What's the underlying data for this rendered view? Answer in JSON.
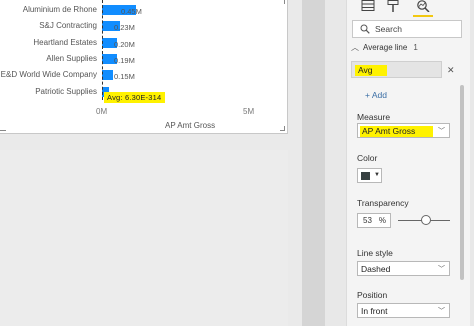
{
  "chart": {
    "categories": [
      {
        "label": "Aluminium de Rhone",
        "value": 0.45,
        "value_label": "0.45M"
      },
      {
        "label": "S&J Contracting",
        "value": 0.23,
        "value_label": "0.23M"
      },
      {
        "label": "Heartland Estates",
        "value": 0.2,
        "value_label": "0.20M"
      },
      {
        "label": "Allen Supplies",
        "value": 0.19,
        "value_label": "0.19M"
      },
      {
        "label": "E&D World Wide Company",
        "value": 0.15,
        "value_label": "0.15M"
      },
      {
        "label": "Patriotic Supplies",
        "value": 0.09,
        "value_label": ""
      }
    ],
    "ticks": [
      "0M",
      "5M"
    ],
    "xlabel": "AP Amt Gross",
    "avg_label": "Avg: 6.30E-314",
    "bar_color": "#118dff"
  },
  "pane": {
    "search_placeholder": "Search",
    "section_title": "Average line",
    "section_count": "1",
    "line_name": "Avg",
    "add_label": "+ Add",
    "measure_label": "Measure",
    "measure_value": "AP Amt Gross",
    "color_label": "Color",
    "color_value": "#374142",
    "transparency_label": "Transparency",
    "transparency_value": "53",
    "transparency_unit": "%",
    "line_style_label": "Line style",
    "line_style_value": "Dashed",
    "position_label": "Position",
    "position_value": "In front",
    "highlight_color": "#fff200",
    "accent_color": "#f2c811"
  }
}
